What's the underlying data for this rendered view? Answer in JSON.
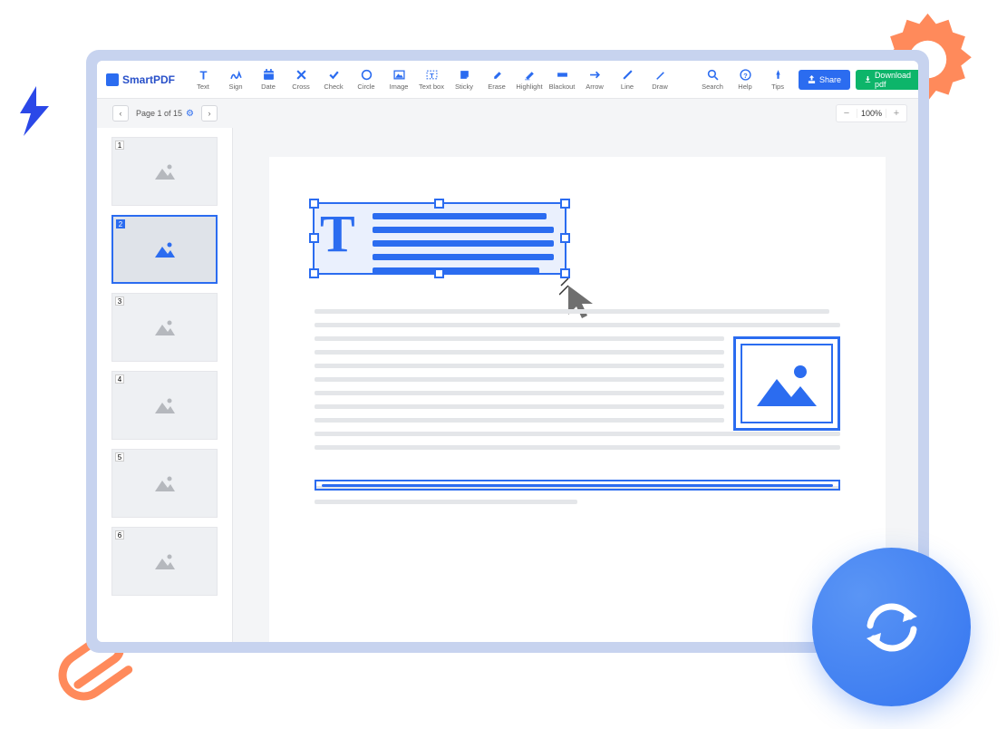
{
  "brand": "SmartPDF",
  "tools": [
    {
      "label": "Text",
      "icon": "T"
    },
    {
      "label": "Sign",
      "icon": "sign"
    },
    {
      "label": "Date",
      "icon": "date"
    },
    {
      "label": "Cross",
      "icon": "cross"
    },
    {
      "label": "Check",
      "icon": "check"
    },
    {
      "label": "Circle",
      "icon": "circle"
    },
    {
      "label": "Image",
      "icon": "image"
    },
    {
      "label": "Text box",
      "icon": "textbox"
    },
    {
      "label": "Sticky",
      "icon": "sticky"
    },
    {
      "label": "Erase",
      "icon": "erase"
    },
    {
      "label": "Highlight",
      "icon": "highlight"
    },
    {
      "label": "Blackout",
      "icon": "blackout"
    },
    {
      "label": "Arrow",
      "icon": "arrow"
    },
    {
      "label": "Line",
      "icon": "line"
    },
    {
      "label": "Draw",
      "icon": "draw"
    }
  ],
  "utils": [
    {
      "label": "Search",
      "icon": "search"
    },
    {
      "label": "Help",
      "icon": "help"
    },
    {
      "label": "Tips",
      "icon": "tips"
    }
  ],
  "buttons": {
    "share": "Share",
    "download": "Download pdf"
  },
  "pageinfo": "Page 1 of 15",
  "zoom": "100%",
  "thumbs": [
    1,
    2,
    3,
    4,
    5,
    6
  ],
  "active_thumb": 2
}
